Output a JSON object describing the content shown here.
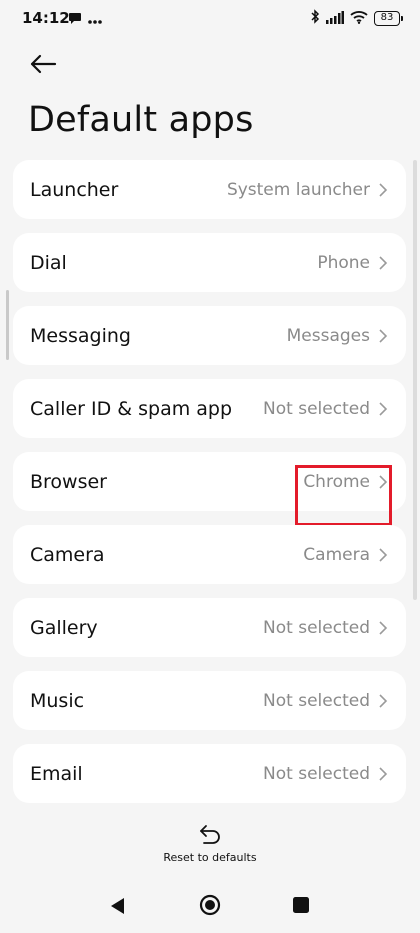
{
  "status_bar": {
    "time": "14:12",
    "battery": "83",
    "left_icons": [
      "chat-bubble-icon",
      "more-dots-icon"
    ],
    "right_icons": [
      "bluetooth-icon",
      "signal-icon",
      "wifi-icon",
      "battery-icon"
    ]
  },
  "header": {
    "back_icon": "arrow-left-icon",
    "title": "Default apps"
  },
  "list": {
    "items": [
      {
        "label": "Launcher",
        "value": "System launcher"
      },
      {
        "label": "Dial",
        "value": "Phone"
      },
      {
        "label": "Messaging",
        "value": "Messages"
      },
      {
        "label": "Caller ID & spam app",
        "value": "Not selected"
      },
      {
        "label": "Browser",
        "value": "Chrome"
      },
      {
        "label": "Camera",
        "value": "Camera"
      },
      {
        "label": "Gallery",
        "value": "Not selected"
      },
      {
        "label": "Music",
        "value": "Not selected"
      },
      {
        "label": "Email",
        "value": "Not selected"
      }
    ]
  },
  "footer": {
    "reset_label": "Reset to defaults",
    "reset_icon": "undo-icon"
  },
  "nav": {
    "icons": [
      "back-triangle-icon",
      "home-circle-icon",
      "recents-square-icon"
    ]
  },
  "colors": {
    "background": "#f5f5f5",
    "card": "#ffffff",
    "value_text": "#8a8a8a",
    "highlight": "#e31b2a"
  }
}
